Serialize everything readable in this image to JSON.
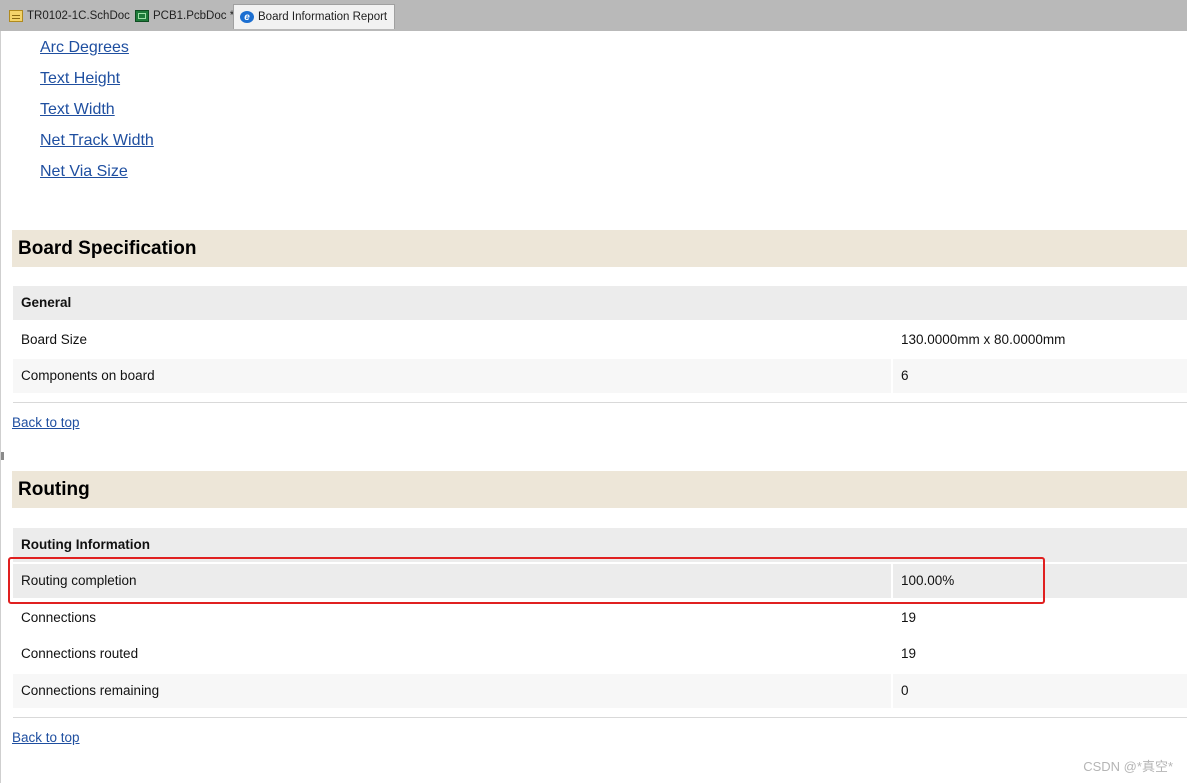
{
  "tabs": [
    {
      "label": "TR0102-1C.SchDoc",
      "icon": "schematic-doc-icon"
    },
    {
      "label": "PCB1.PcbDoc *",
      "icon": "pcb-doc-icon"
    },
    {
      "label": "Board Information Report",
      "icon": "browser-e-icon",
      "icon_glyph": "e"
    }
  ],
  "toc_links": [
    "Arc Degrees",
    "Text Height",
    "Text Width",
    "Net Track Width",
    "Net Via Size"
  ],
  "board_spec": {
    "title": "Board Specification",
    "group": "General",
    "rows": [
      {
        "label": "Board Size",
        "value": "130.0000mm  x  80.0000mm"
      },
      {
        "label": "Components on board",
        "value": "6"
      }
    ],
    "back_to_top": "Back to top"
  },
  "routing": {
    "title": "Routing",
    "group": "Routing Information",
    "rows": [
      {
        "label": "Routing completion",
        "value": "100.00%"
      },
      {
        "label": "Connections",
        "value": "19"
      },
      {
        "label": "Connections routed",
        "value": "19"
      },
      {
        "label": "Connections remaining",
        "value": "0"
      }
    ],
    "back_to_top": "Back to top"
  },
  "watermark": "CSDN @*真空*",
  "colors": {
    "highlight": "#e02020",
    "link": "#1f4fa0",
    "section_bg": "#ede6d8"
  }
}
